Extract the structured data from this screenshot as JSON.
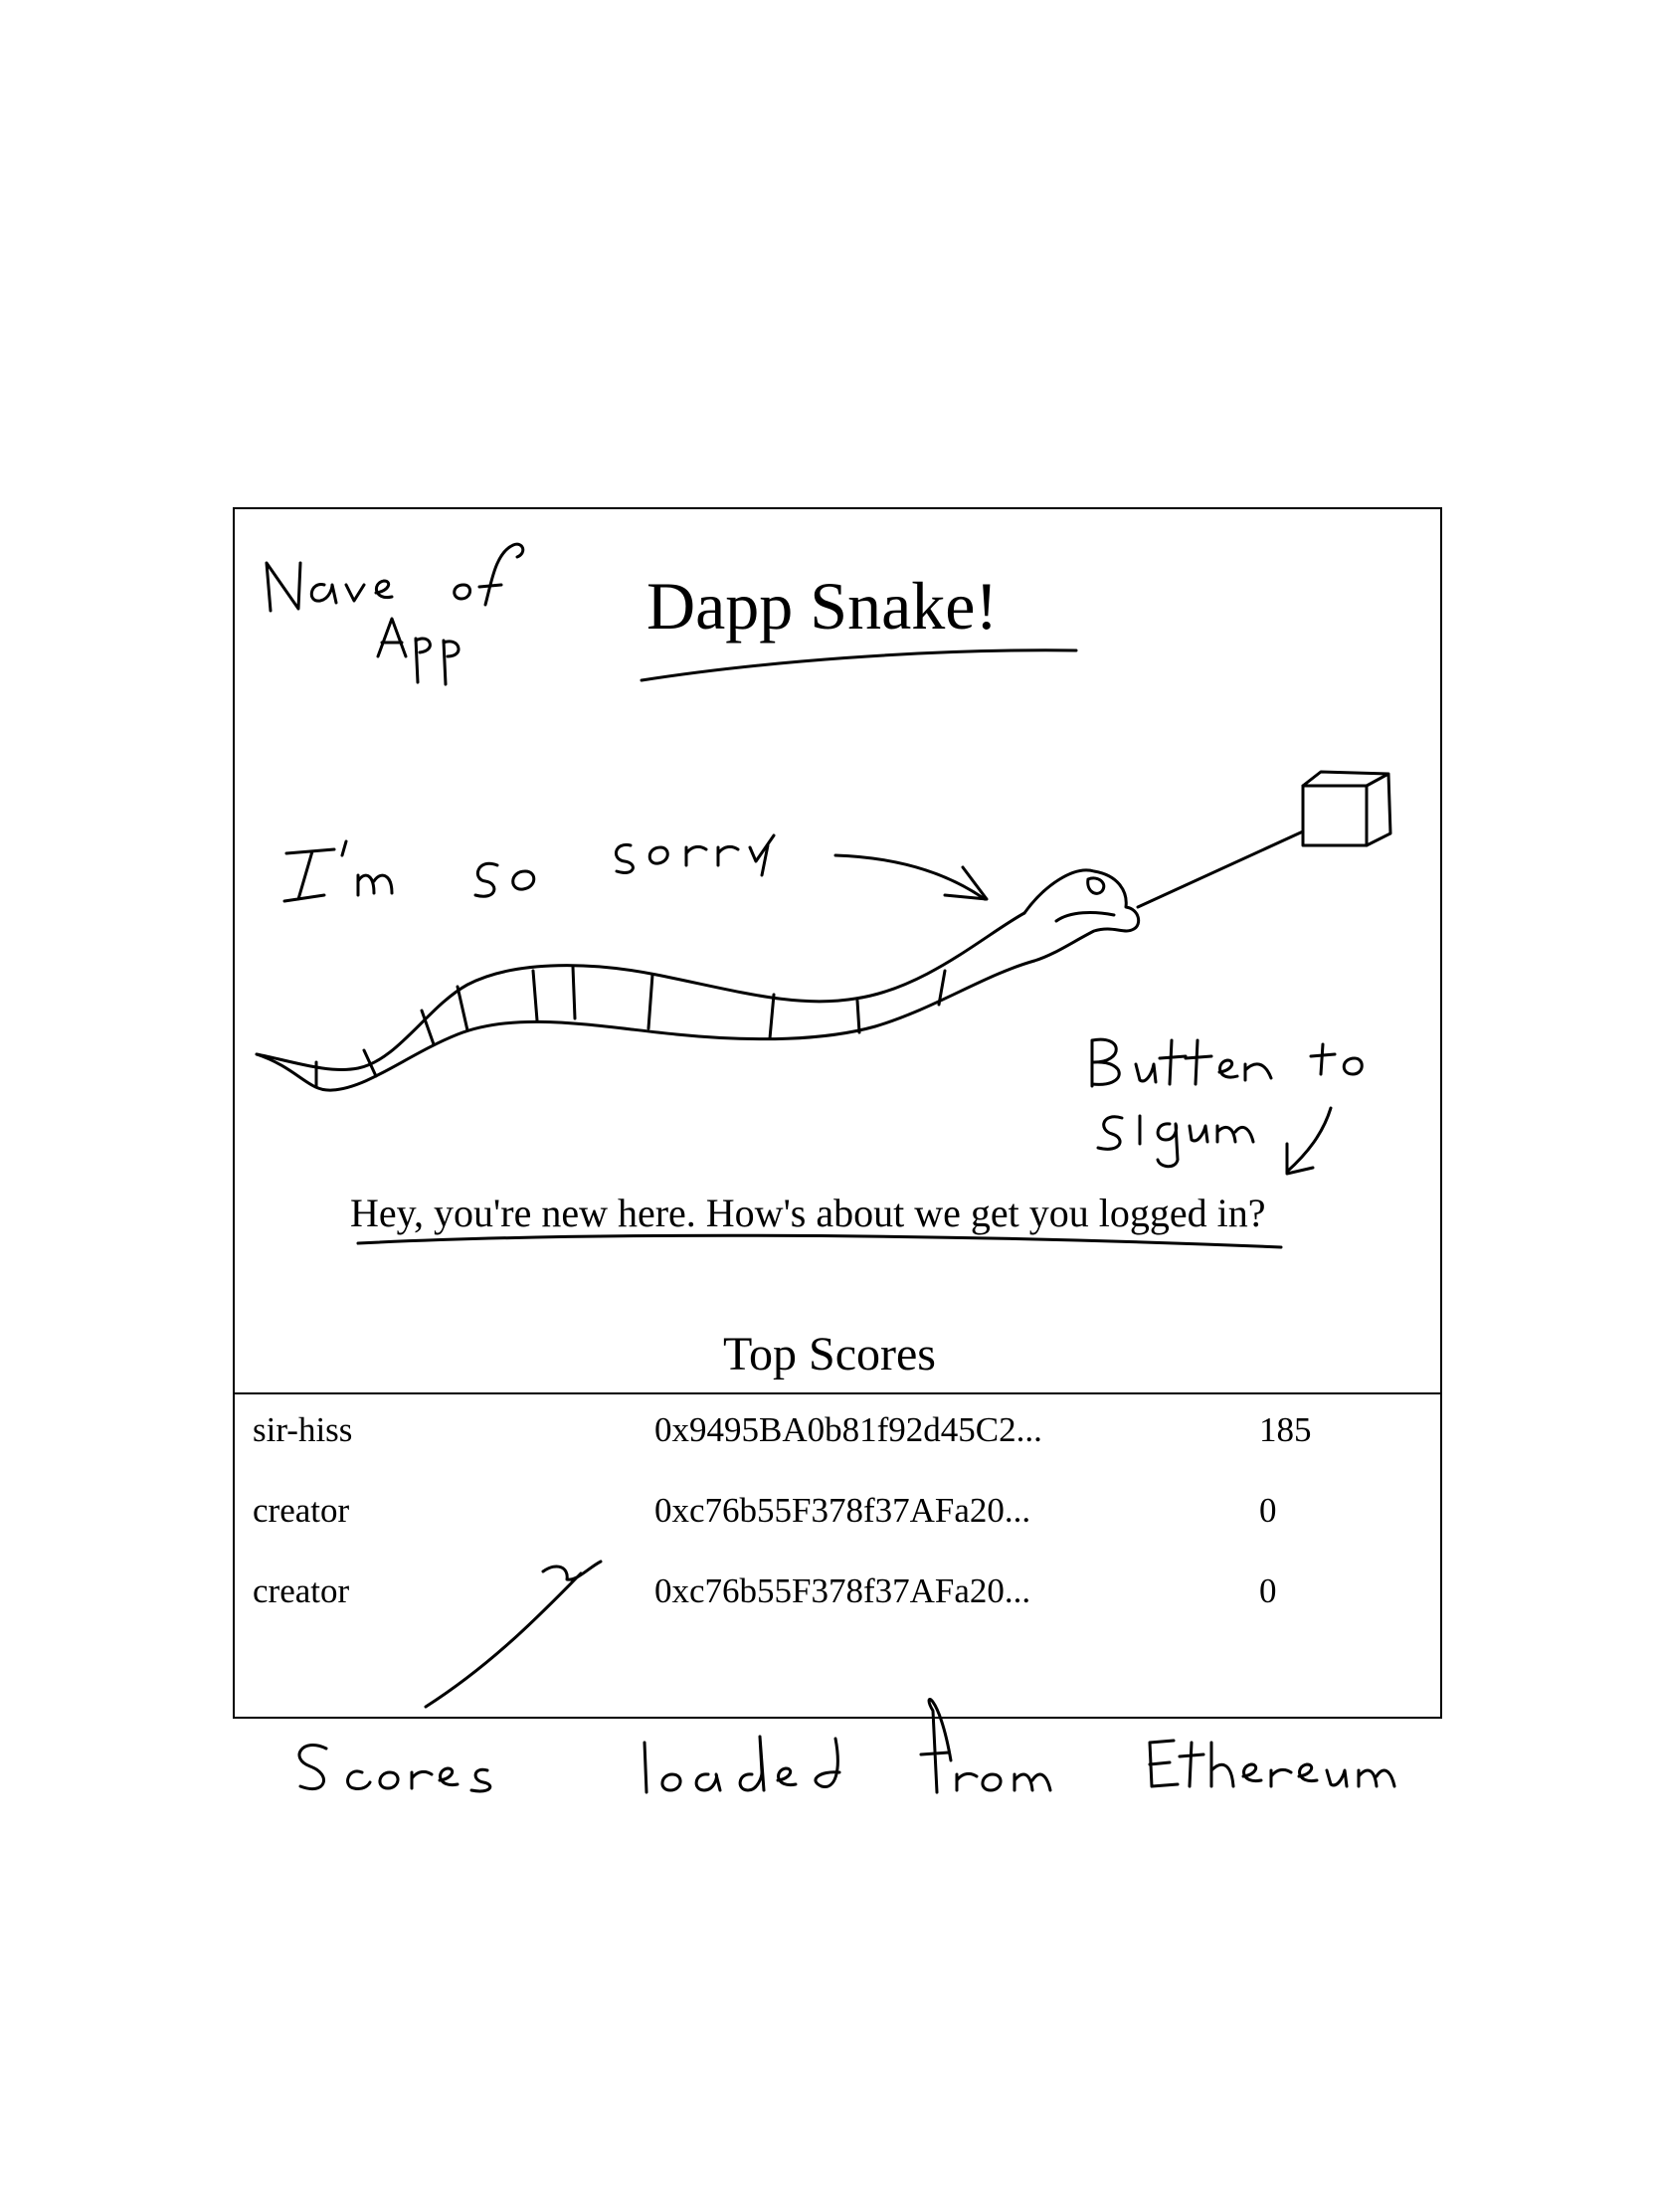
{
  "app": {
    "title": "Dapp Snake!",
    "login_prompt": "Hey, you're new here. How's about we get you logged in?"
  },
  "scores": {
    "heading": "Top Scores",
    "rows": [
      {
        "name": "sir-hiss",
        "address": "0x9495BA0b81f92d45C2...",
        "score": "185"
      },
      {
        "name": "creator",
        "address": "0xc76b55F378f37AFa20...",
        "score": "0"
      },
      {
        "name": "creator",
        "address": "0xc76b55F378f37AFa20...",
        "score": "0"
      }
    ]
  },
  "annotations": {
    "name_of_app": "Name of App",
    "im_so_sorry": "I'm so sorry",
    "button_to_signin": "Button to signin",
    "scores_loaded": "Scores loaded from Ethereum"
  },
  "colors": {
    "ink": "#000000",
    "background": "#ffffff"
  }
}
